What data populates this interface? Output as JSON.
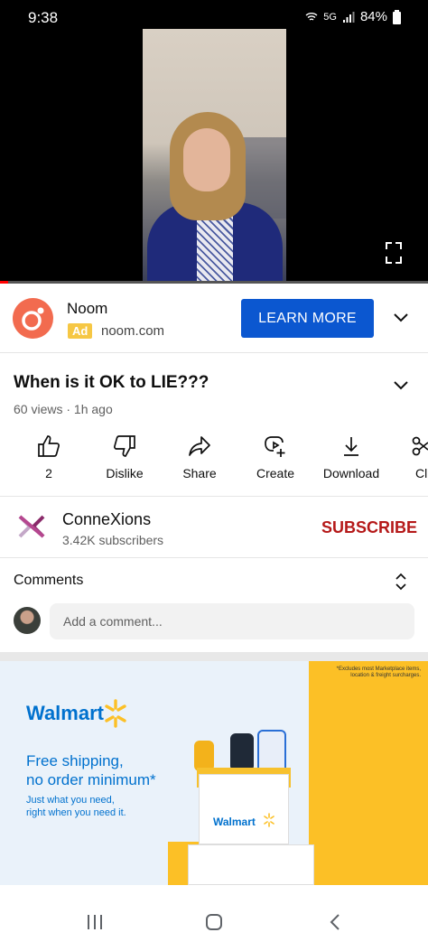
{
  "status_bar": {
    "time": "9:38",
    "network": "5G",
    "battery": "84%"
  },
  "video": {
    "progress_fraction": 0.02
  },
  "ad": {
    "advertiser": "Noom",
    "badge": "Ad",
    "domain": "noom.com",
    "cta": "LEARN MORE",
    "logo_color": "#f26b4f",
    "cta_color": "#0b57d0"
  },
  "video_info": {
    "title": "When is it OK to LIE???",
    "meta": "60 views · 1h ago"
  },
  "actions": [
    {
      "label": "2",
      "icon": "thumbs-up-icon"
    },
    {
      "label": "Dislike",
      "icon": "thumbs-down-icon"
    },
    {
      "label": "Share",
      "icon": "share-icon"
    },
    {
      "label": "Create",
      "icon": "create-icon"
    },
    {
      "label": "Download",
      "icon": "download-icon"
    },
    {
      "label": "Cl",
      "icon": "clip-icon"
    }
  ],
  "channel": {
    "name": "ConneXions",
    "subscribers": "3.42K subscribers",
    "subscribe_label": "SUBSCRIBE",
    "subscribe_color": "#b51919"
  },
  "comments": {
    "title": "Comments",
    "placeholder": "Add a comment..."
  },
  "walmart_ad": {
    "fine_print": "*Excludes most Marketplace items, location & freight surcharges.",
    "logo": "Walmart",
    "headline_1": "Free shipping,",
    "headline_2": "no order minimum*",
    "sub_1": "Just what you need,",
    "sub_2": "right when you need it.",
    "box_logo": "Walmart"
  },
  "nav": {
    "icons": [
      "recents-icon",
      "home-icon",
      "back-icon"
    ]
  }
}
